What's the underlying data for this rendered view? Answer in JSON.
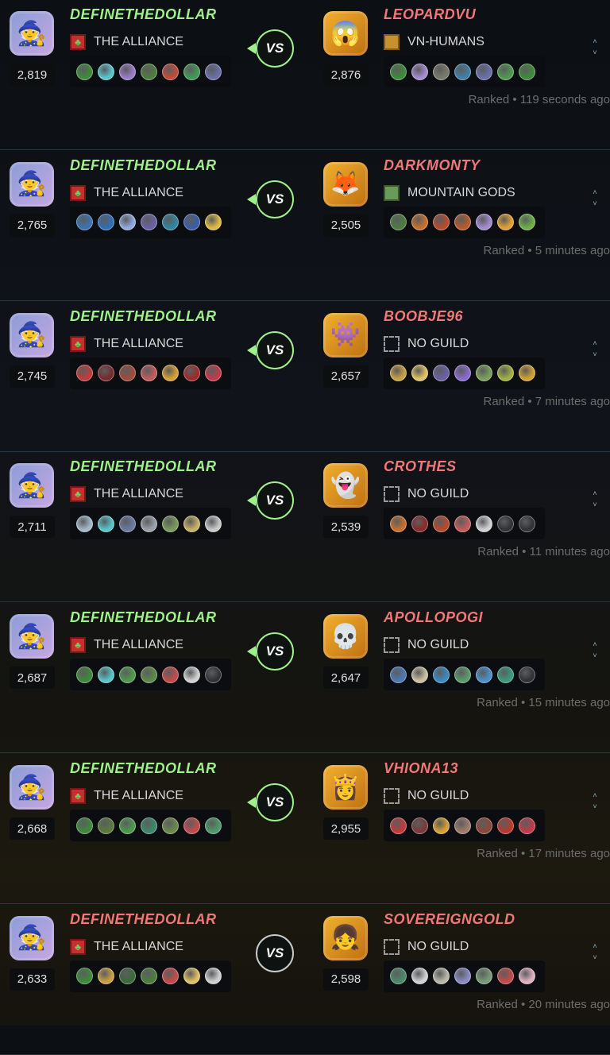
{
  "battles": [
    {
      "vs": "VS",
      "vs_style": "active",
      "status": "Ranked • 119 seconds ago",
      "player": {
        "name": "DEFINETHEDOLLAR",
        "name_color": "#9ff08a",
        "rating": "2,819",
        "guild": "THE ALLIANCE",
        "guild_icon": "red-green-banner-icon",
        "avatar_icon": "wizard-avatar-icon",
        "cards": [
          "#3d8a3a",
          "#56c5c9",
          "#9c7cc8",
          "#4d7d3e",
          "#c44a3a",
          "#3f9a55",
          "#6a6fa8"
        ]
      },
      "opponent": {
        "name": "LEOPARDVU",
        "name_color": "#f07878",
        "rating": "2,876",
        "guild": "VN-HUMANS",
        "guild_icon": "gold-banner-icon",
        "avatar_icon": "monster-mouth-avatar-icon",
        "cards": [
          "#3d8a3a",
          "#a48ad0",
          "#7a7a6a",
          "#3f7fa8",
          "#6a6fa8",
          "#4d9a4d",
          "#3d8a3a"
        ]
      }
    },
    {
      "vs": "VS",
      "vs_style": "active",
      "status": "Ranked • 5 minutes ago",
      "player": {
        "name": "DEFINETHEDOLLAR",
        "name_color": "#9ff08a",
        "rating": "2,765",
        "guild": "THE ALLIANCE",
        "guild_icon": "red-green-banner-icon",
        "avatar_icon": "wizard-avatar-icon",
        "cards": [
          "#3a72b0",
          "#2f6fb8",
          "#8faae0",
          "#6a62a8",
          "#2f86a0",
          "#3a5fa8",
          "#e0b940"
        ]
      },
      "opponent": {
        "name": "DARKMONTY",
        "name_color": "#f07878",
        "rating": "2,505",
        "guild": "MOUNTAIN GODS",
        "guild_icon": "green-banner-icon",
        "avatar_icon": "fox-avatar-icon",
        "cards": [
          "#4d7d3e",
          "#c8702a",
          "#b84a2a",
          "#b85a2a",
          "#a48ad0",
          "#e0a030",
          "#6ab040"
        ]
      }
    },
    {
      "vs": "VS",
      "vs_style": "active",
      "status": "Ranked • 7 minutes ago",
      "player": {
        "name": "DEFINETHEDOLLAR",
        "name_color": "#9ff08a",
        "rating": "2,745",
        "guild": "THE ALLIANCE",
        "guild_icon": "red-green-banner-icon",
        "avatar_icon": "wizard-avatar-icon",
        "cards": [
          "#c43a3a",
          "#7a2a2a",
          "#a04a3a",
          "#c45a5a",
          "#d8a030",
          "#a02a2a",
          "#c43a4a"
        ]
      },
      "opponent": {
        "name": "BOOBJE96",
        "name_color": "#f07878",
        "rating": "2,657",
        "guild": "NO GUILD",
        "guild_icon": "empty-banner-icon",
        "avatar_icon": "creature-avatar-icon",
        "cards": [
          "#c8a040",
          "#e0c060",
          "#6a62a8",
          "#8a6ad0",
          "#7aa05a",
          "#a0b040",
          "#d0a030"
        ]
      }
    },
    {
      "vs": "VS",
      "vs_style": "active",
      "status": "Ranked • 11 minutes ago",
      "player": {
        "name": "DEFINETHEDOLLAR",
        "name_color": "#9ff08a",
        "rating": "2,711",
        "guild": "THE ALLIANCE",
        "guild_icon": "red-green-banner-icon",
        "avatar_icon": "wizard-avatar-icon",
        "cards": [
          "#a0b8c8",
          "#56c5c9",
          "#6a7aa0",
          "#9aa0a8",
          "#7a9a5a",
          "#c8b060",
          "#c8c8c8"
        ]
      },
      "opponent": {
        "name": "CROTHES",
        "name_color": "#f07878",
        "rating": "2,539",
        "guild": "NO GUILD",
        "guild_icon": "empty-banner-icon",
        "avatar_icon": "ghost-avatar-icon",
        "cards": [
          "#c8702a",
          "#8a2a2a",
          "#b84a2a",
          "#c45a5a",
          "#d0d0d0",
          "#303235",
          "#303235"
        ]
      }
    },
    {
      "vs": "VS",
      "vs_style": "active",
      "status": "Ranked • 15 minutes ago",
      "player": {
        "name": "DEFINETHEDOLLAR",
        "name_color": "#9ff08a",
        "rating": "2,687",
        "guild": "THE ALLIANCE",
        "guild_icon": "red-green-banner-icon",
        "avatar_icon": "wizard-avatar-icon",
        "cards": [
          "#3d8a3a",
          "#56c5c9",
          "#4d9a4d",
          "#5a8a4a",
          "#c44a4a",
          "#d0d0d0",
          "#303235"
        ]
      },
      "opponent": {
        "name": "APOLLOPOGI",
        "name_color": "#f07878",
        "rating": "2,647",
        "guild": "NO GUILD",
        "guild_icon": "empty-banner-icon",
        "avatar_icon": "skull-avatar-icon",
        "cards": [
          "#4a7ab0",
          "#c8c0a0",
          "#3a8ac0",
          "#5a9a6a",
          "#4a90c8",
          "#3a9a7a",
          "#303235"
        ]
      }
    },
    {
      "vs": "VS",
      "vs_style": "active",
      "status": "Ranked • 17 minutes ago",
      "player": {
        "name": "DEFINETHEDOLLAR",
        "name_color": "#9ff08a",
        "rating": "2,668",
        "guild": "THE ALLIANCE",
        "guild_icon": "red-green-banner-icon",
        "avatar_icon": "wizard-avatar-icon",
        "cards": [
          "#3d8a3a",
          "#5a7a3a",
          "#4d9a4d",
          "#3a8a6a",
          "#6a8a4a",
          "#c44a4a",
          "#4d9a6a"
        ]
      },
      "opponent": {
        "name": "VHIONA13",
        "name_color": "#f07878",
        "rating": "2,955",
        "guild": "NO GUILD",
        "guild_icon": "empty-banner-icon",
        "avatar_icon": "blonde-avatar-icon",
        "cards": [
          "#c43a3a",
          "#7a3a3a",
          "#d8a030",
          "#a07a6a",
          "#8a4a3a",
          "#b83a2a",
          "#c43a4a"
        ]
      }
    },
    {
      "vs": "VS",
      "vs_style": "inactive",
      "status": "Ranked • 20 minutes ago",
      "player": {
        "name": "DEFINETHEDOLLAR",
        "name_color": "#f07878",
        "rating": "2,633",
        "guild": "THE ALLIANCE",
        "guild_icon": "red-green-banner-icon",
        "avatar_icon": "wizard-avatar-icon",
        "cards": [
          "#3d8a3a",
          "#c8a040",
          "#3a6a3a",
          "#4d7d3e",
          "#c44a4a",
          "#e0c060",
          "#d0d0d0"
        ]
      },
      "opponent": {
        "name": "SOVEREIGNGOLD",
        "name_color": "#f07878",
        "rating": "2,598",
        "guild": "NO GUILD",
        "guild_icon": "empty-banner-icon",
        "avatar_icon": "girl-avatar-icon",
        "cards": [
          "#4a8a6a",
          "#d0d0d0",
          "#b8b8a8",
          "#8a8ac8",
          "#7a9a7a",
          "#c44a4a",
          "#e0b0c0"
        ]
      }
    }
  ],
  "colors": {
    "accent": "#9ff08a",
    "loss": "#f07878",
    "inactive_vs": "#c9c9c9"
  }
}
